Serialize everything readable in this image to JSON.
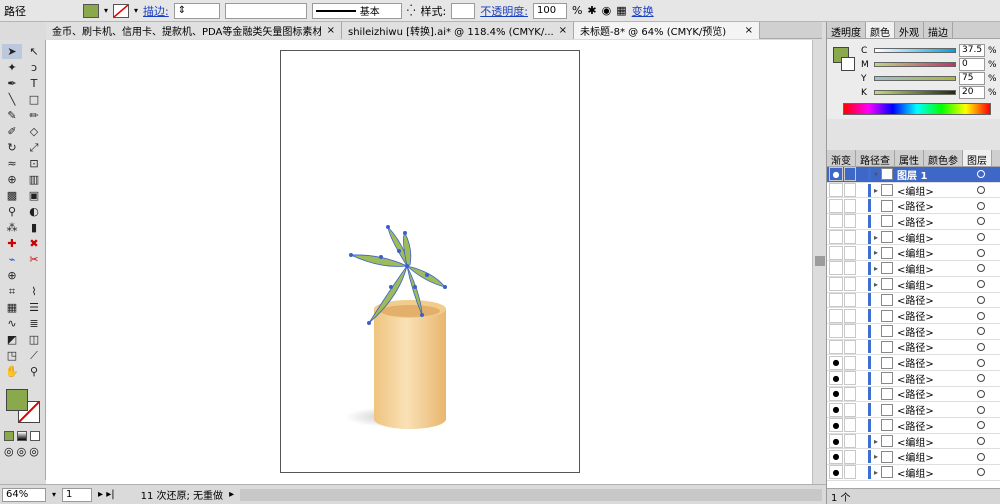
{
  "control_bar": {
    "mode_label": "路径",
    "stroke_link": "描边:",
    "stroke_style": "基本",
    "style_label": "样式:",
    "opacity_link": "不透明度:",
    "opacity_value": "100",
    "opacity_unit": "%",
    "transform_link": "变换"
  },
  "doc_tabs": [
    {
      "label": "金币、刷卡机、信用卡、提款机、PDA等金融类矢量图标素材 [转换].AI* @ ...",
      "close": "×"
    },
    {
      "label": "shileizhiwu [转换].ai* @ 118.4% (CMYK/...",
      "close": "×"
    },
    {
      "label": "未标题-8* @ 64% (CMYK/预览)",
      "close": "×"
    }
  ],
  "color_panel": {
    "tabs": [
      "透明度",
      "颜色",
      "外观",
      "描边"
    ],
    "active_tab": "颜色",
    "channels": [
      {
        "key": "C",
        "value": "37.5",
        "unit": "%"
      },
      {
        "key": "M",
        "value": "0",
        "unit": "%"
      },
      {
        "key": "Y",
        "value": "75",
        "unit": "%"
      },
      {
        "key": "K",
        "value": "20",
        "unit": "%"
      }
    ],
    "fill_color": "#8aa84c"
  },
  "layers_panel": {
    "tabs": [
      "渐变",
      "路径查",
      "属性",
      "颜色参",
      "图层"
    ],
    "active_tab": "图层",
    "rows": [
      {
        "label": "图层 1",
        "kind": "layer"
      },
      {
        "label": "<编组>",
        "kind": "group"
      },
      {
        "label": "<路径>",
        "kind": "path"
      },
      {
        "label": "<路径>",
        "kind": "path"
      },
      {
        "label": "<编组>",
        "kind": "group"
      },
      {
        "label": "<编组>",
        "kind": "group"
      },
      {
        "label": "<编组>",
        "kind": "group"
      },
      {
        "label": "<编组>",
        "kind": "group"
      },
      {
        "label": "<路径>",
        "kind": "path"
      },
      {
        "label": "<路径>",
        "kind": "path"
      },
      {
        "label": "<路径>",
        "kind": "path"
      },
      {
        "label": "<路径>",
        "kind": "path"
      },
      {
        "label": "<路径>",
        "kind": "path"
      },
      {
        "label": "<路径>",
        "kind": "path"
      },
      {
        "label": "<路径>",
        "kind": "path"
      },
      {
        "label": "<路径>",
        "kind": "path"
      },
      {
        "label": "<路径>",
        "kind": "path"
      },
      {
        "label": "<编组>",
        "kind": "group"
      },
      {
        "label": "<编组>",
        "kind": "group"
      },
      {
        "label": "<编组>",
        "kind": "group"
      }
    ],
    "footer": "1 个"
  },
  "status_bar": {
    "zoom": "64%",
    "artboard": "1",
    "history": "11 次还原; 无重做"
  }
}
